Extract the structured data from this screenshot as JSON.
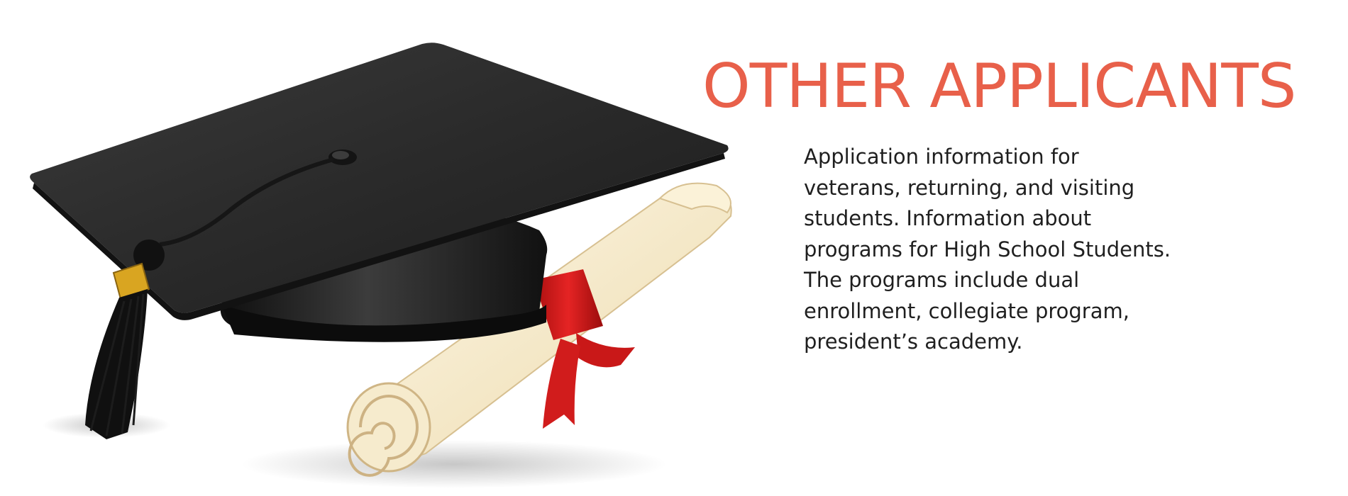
{
  "banner": {
    "title": "OTHER APPLICANTS",
    "description": "Application information for veterans, returning, and visiting students. Information about programs for High School Students. The programs include dual enrollment, collegiate program, president’s academy."
  },
  "colors": {
    "title": "#e8604a",
    "body_text": "#1f1f1f",
    "background": "#ffffff",
    "cap": "#1e1e1e",
    "diploma": "#f3e7c8",
    "ribbon": "#d61a1a",
    "tassel_band": "#d9a521"
  },
  "icons": {
    "illustration": "graduation-cap-and-diploma"
  }
}
